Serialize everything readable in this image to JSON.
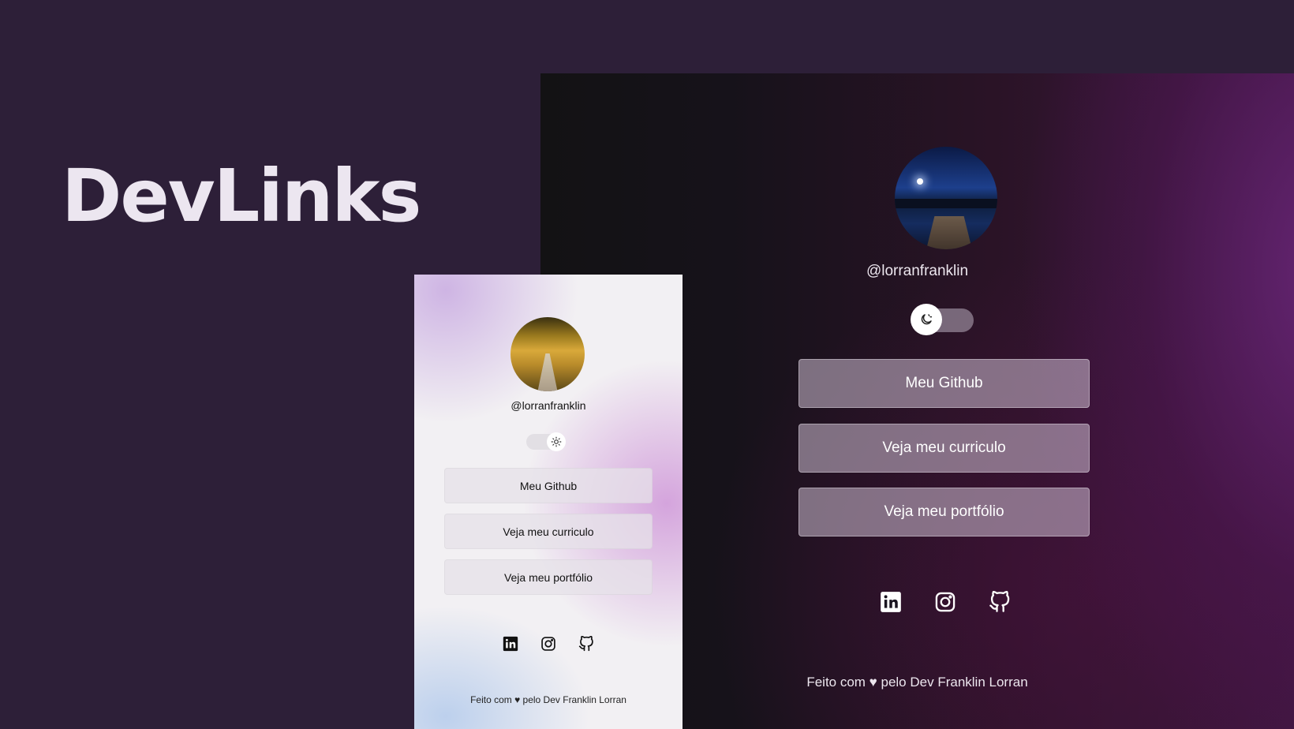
{
  "brand": {
    "title": "DevLinks"
  },
  "dark_preview": {
    "handle": "@lorranfranklin",
    "theme_toggle": {
      "state": "dark",
      "icon": "moon-icon"
    },
    "buttons": [
      "Meu Github",
      "Veja meu curriculo",
      "Veja meu portfólio"
    ],
    "socials": [
      "linkedin-icon",
      "instagram-icon",
      "github-icon"
    ],
    "footer": "Feito com ♥ pelo Dev Franklin Lorran"
  },
  "light_preview": {
    "handle": "@lorranfranklin",
    "theme_toggle": {
      "state": "light",
      "icon": "sun-icon"
    },
    "buttons": [
      "Meu Github",
      "Veja meu curriculo",
      "Veja meu portfólio"
    ],
    "socials": [
      "linkedin-icon",
      "instagram-icon",
      "github-icon"
    ],
    "footer": "Feito com ♥ pelo Dev Franklin Lorran"
  },
  "colors": {
    "background": "#2d1f38",
    "dark_accent": "#5c2466",
    "light_accent": "#cda0dc"
  }
}
